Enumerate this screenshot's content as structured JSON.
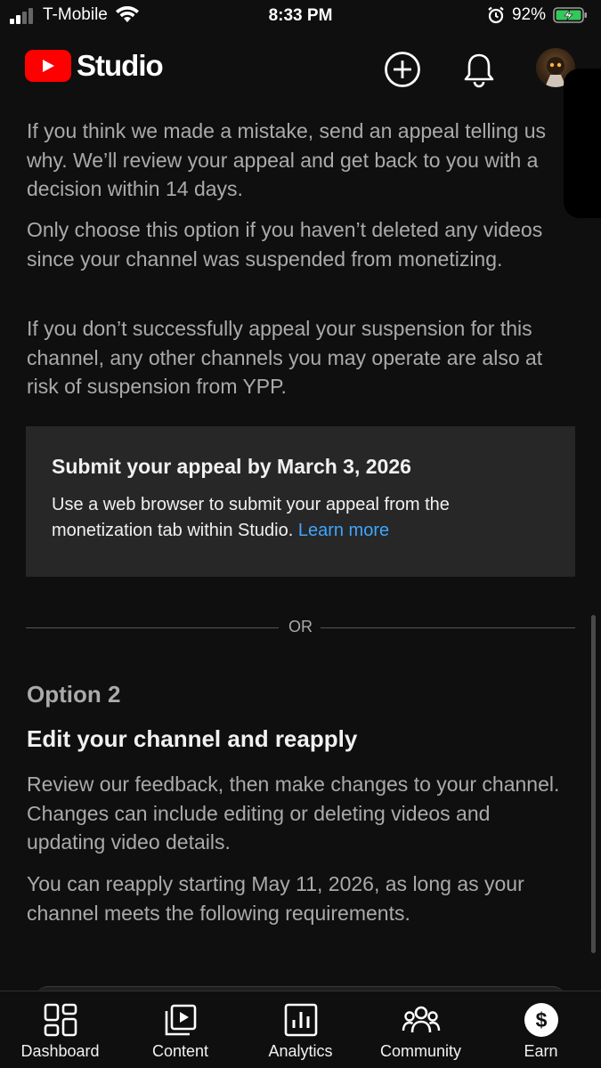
{
  "status_bar": {
    "carrier": "T-Mobile",
    "time": "8:33 PM",
    "battery_pct": "92%"
  },
  "header": {
    "logo_text": "Studio",
    "icons": [
      "create-icon",
      "bell-icon",
      "avatar"
    ]
  },
  "content": {
    "para1": "If you think we made a mistake, send an appeal telling us why. We’ll review your appeal and get back to you with a decision within 14 days.",
    "para2": "Only choose this option if you haven’t deleted any videos since your channel was suspended from monetizing.",
    "para3": "If you don’t successfully appeal your suspension for this channel, any other channels you may operate are also at risk of suspension from YPP.",
    "appeal_box": {
      "title": "Submit your appeal by March 3, 2026",
      "body": "Use a web browser to submit your appeal from the monetization tab within Studio.",
      "link": "Learn more"
    },
    "or_text": "OR",
    "option_label": "Option 2",
    "option_heading": "Edit your channel and reapply",
    "para4": "Review our feedback, then make changes to your channel. Changes can include editing or deleting videos and updating video details.",
    "para5": "You can reapply starting May 11, 2026, as long as your channel meets the following requirements."
  },
  "bottom_nav": {
    "items": [
      {
        "label": "Dashboard",
        "icon": "dashboard-icon"
      },
      {
        "label": "Content",
        "icon": "content-icon"
      },
      {
        "label": "Analytics",
        "icon": "analytics-icon"
      },
      {
        "label": "Community",
        "icon": "community-icon"
      },
      {
        "label": "Earn",
        "icon": "earn-icon"
      }
    ]
  },
  "colors": {
    "background": "#0f0f0f",
    "card": "#272727",
    "link": "#3ea6ff",
    "brand_red": "#ff0000",
    "muted_text": "#aaaaaa"
  }
}
